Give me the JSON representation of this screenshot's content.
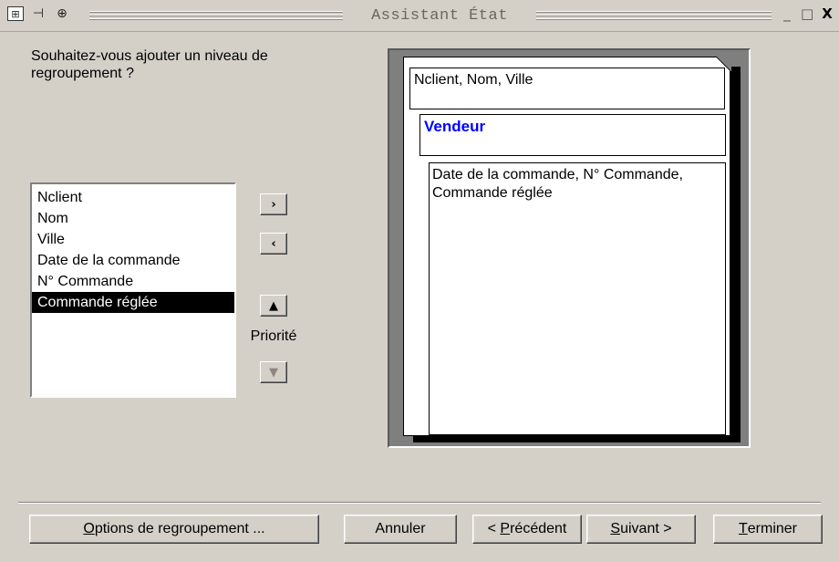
{
  "window": {
    "title": "Assistant État",
    "minimize": "_",
    "maximize": "□",
    "close": "X"
  },
  "question": "Souhaitez-vous ajouter un niveau de regroupement ?",
  "fields": [
    "Nclient",
    "Nom",
    "Ville",
    "Date de la commande",
    "N° Commande",
    "Commande réglée"
  ],
  "selected_field": "Commande réglée",
  "shuttle": {
    "add": "›",
    "remove": "‹",
    "priority_up": "▲",
    "priority_down": "▼",
    "priority_label": "Priorité"
  },
  "preview": {
    "header_fields": "Nclient, Nom, Ville",
    "group_level": "Vendeur",
    "detail_fields": "Date de la commande, N° Commande, Commande réglée"
  },
  "buttons": {
    "options": {
      "accel": "O",
      "rest": "ptions de regroupement ..."
    },
    "cancel": "Annuler",
    "previous": {
      "prefix": "< ",
      "accel": "P",
      "rest": "récédent"
    },
    "next": {
      "accel": "S",
      "rest": "uivant >"
    },
    "finish": {
      "accel": "T",
      "rest": "erminer"
    }
  },
  "colors": {
    "dialog_bg": "#d4d0c8",
    "group_level_text": "#0000ff",
    "selection_bg": "#000000"
  }
}
